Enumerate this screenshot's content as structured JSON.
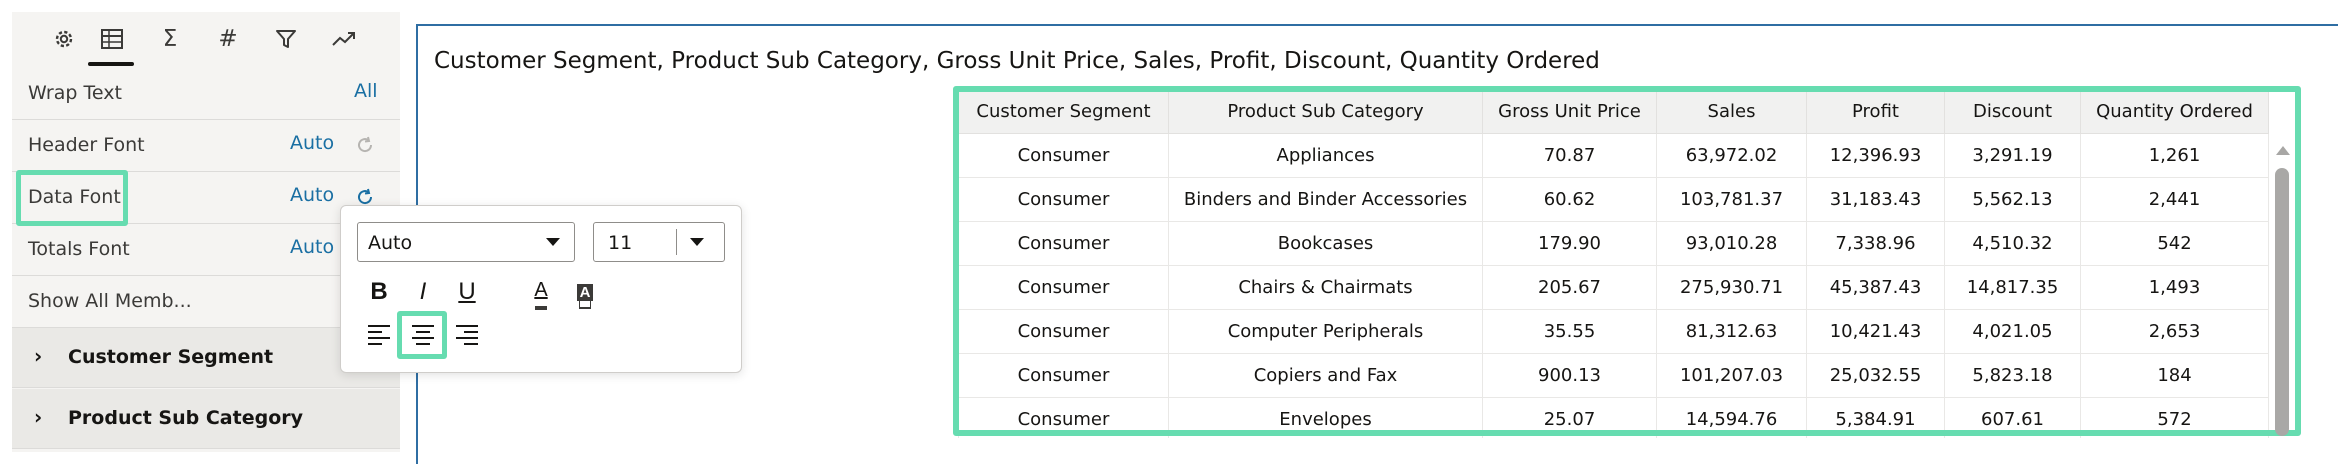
{
  "panel": {
    "tabs": [
      {
        "icon": "gear-icon"
      },
      {
        "icon": "table-icon"
      },
      {
        "icon": "sigma-icon",
        "glyph": "Σ"
      },
      {
        "icon": "hash-icon",
        "glyph": "#"
      },
      {
        "icon": "filter-icon"
      },
      {
        "icon": "trend-icon"
      }
    ],
    "properties": {
      "wrap_text": {
        "label": "Wrap Text",
        "value": "All"
      },
      "header_font": {
        "label": "Header Font",
        "value": "Auto"
      },
      "data_font": {
        "label": "Data Font",
        "value": "Auto"
      },
      "totals_font": {
        "label": "Totals Font",
        "value": "Auto"
      },
      "show_all_members": {
        "label": "Show All Memb..."
      }
    },
    "sections": [
      {
        "label": "Customer Segment"
      },
      {
        "label": "Product Sub Category"
      }
    ],
    "chevron": "›"
  },
  "font_popup": {
    "font_family": "Auto",
    "font_size": "11",
    "bold": "B",
    "italic": "I",
    "underline": "U",
    "text_color_glyph": "A",
    "background_color_glyph": "A",
    "selected_alignment": "center"
  },
  "view": {
    "title": "Customer Segment, Product Sub Category, Gross Unit Price, Sales, Profit, Discount, Quantity Ordered",
    "table": {
      "columns": [
        "Customer Segment",
        "Product Sub Category",
        "Gross Unit Price",
        "Sales",
        "Profit",
        "Discount",
        "Quantity Ordered"
      ],
      "rows": [
        [
          "Consumer",
          "Appliances",
          "70.87",
          "63,972.02",
          "12,396.93",
          "3,291.19",
          "1,261"
        ],
        [
          "Consumer",
          "Binders and Binder Accessories",
          "60.62",
          "103,781.37",
          "31,183.43",
          "5,562.13",
          "2,441"
        ],
        [
          "Consumer",
          "Bookcases",
          "179.90",
          "93,010.28",
          "7,338.96",
          "4,510.32",
          "542"
        ],
        [
          "Consumer",
          "Chairs & Chairmats",
          "205.67",
          "275,930.71",
          "45,387.43",
          "14,817.35",
          "1,493"
        ],
        [
          "Consumer",
          "Computer Peripherals",
          "35.55",
          "81,312.63",
          "10,421.43",
          "4,021.05",
          "2,653"
        ],
        [
          "Consumer",
          "Copiers and Fax",
          "900.13",
          "101,207.03",
          "25,032.55",
          "5,823.18",
          "184"
        ],
        [
          "Consumer",
          "Envelopes",
          "25.07",
          "14,594.76",
          "5,384.91",
          "607.61",
          "572"
        ]
      ]
    }
  },
  "colors": {
    "highlight": "#66dcb0",
    "link_value": "#1a6fa3",
    "canvas_border": "#2f6ea3"
  }
}
